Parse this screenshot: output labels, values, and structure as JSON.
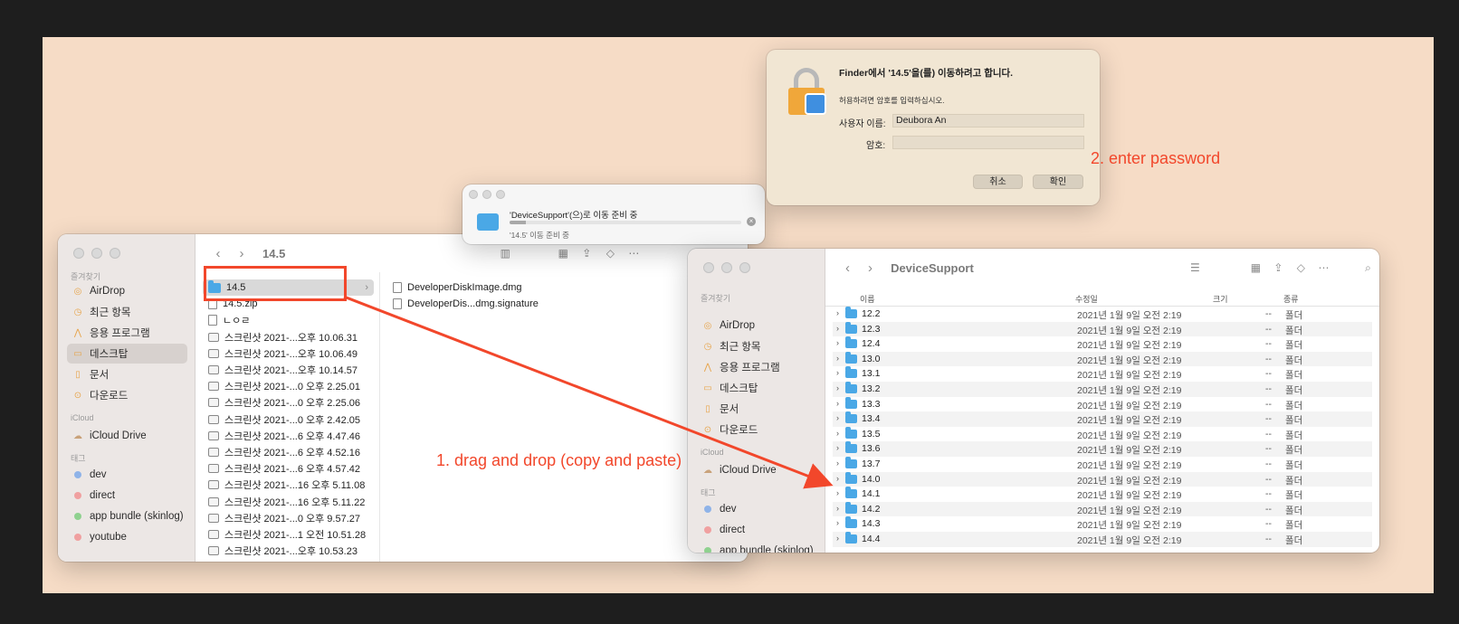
{
  "finder_left": {
    "title": "14.5",
    "sidebar": {
      "favorites_header": "즐겨찾기",
      "favorites": [
        {
          "label": "AirDrop",
          "icon": "airdrop-icon"
        },
        {
          "label": "최근 항목",
          "icon": "clock-icon"
        },
        {
          "label": "응용 프로그램",
          "icon": "apps-icon"
        },
        {
          "label": "데스크탑",
          "icon": "desktop-icon"
        },
        {
          "label": "문서",
          "icon": "document-icon"
        },
        {
          "label": "다운로드",
          "icon": "download-icon"
        }
      ],
      "icloud_header": "iCloud",
      "icloud": [
        {
          "label": "iCloud Drive",
          "icon": "cloud-icon"
        }
      ],
      "tags_header": "태그",
      "tags": [
        {
          "label": "dev",
          "color": "#8fb3e8"
        },
        {
          "label": "direct",
          "color": "#f0a0a0"
        },
        {
          "label": "app bundle (skinlog)",
          "color": "#8fd18f"
        },
        {
          "label": "youtube",
          "color": "#f0a0a0"
        }
      ]
    },
    "column1": [
      {
        "name": "14.5",
        "type": "folder"
      },
      {
        "name": "14.5.zip",
        "type": "zip"
      },
      {
        "name": "ㄴㅇㄹ",
        "type": "file"
      },
      {
        "name": "스크린샷 2021-...오후 10.06.31",
        "type": "image"
      },
      {
        "name": "스크린샷 2021-...오후 10.06.49",
        "type": "image"
      },
      {
        "name": "스크린샷 2021-...오후 10.14.57",
        "type": "image"
      },
      {
        "name": "스크린샷 2021-...0 오후 2.25.01",
        "type": "image"
      },
      {
        "name": "스크린샷 2021-...0 오후 2.25.06",
        "type": "image"
      },
      {
        "name": "스크린샷 2021-...0 오후 2.42.05",
        "type": "image"
      },
      {
        "name": "스크린샷 2021-...6 오후 4.47.46",
        "type": "image"
      },
      {
        "name": "스크린샷 2021-...6 오후 4.52.16",
        "type": "image"
      },
      {
        "name": "스크린샷 2021-...6 오후 4.57.42",
        "type": "image"
      },
      {
        "name": "스크린샷 2021-...16 오후 5.11.08",
        "type": "image"
      },
      {
        "name": "스크린샷 2021-...16 오후 5.11.22",
        "type": "image"
      },
      {
        "name": "스크린샷 2021-...0 오후 9.57.27",
        "type": "image"
      },
      {
        "name": "스크린샷 2021-...1 오전 10.51.28",
        "type": "image"
      },
      {
        "name": "스크린샷 2021-...오후 10.53.23",
        "type": "image"
      }
    ],
    "column2": [
      {
        "name": "DeveloperDiskImage.dmg",
        "type": "file"
      },
      {
        "name": "DeveloperDis...dmg.signature",
        "type": "file"
      }
    ]
  },
  "progress": {
    "title": "'DeviceSupport'(으)로 이동 준비 중",
    "status": "'14.5' 이동 준비 중",
    "fraction": 0.07
  },
  "auth": {
    "title": "Finder에서 '14.5'을(를) 이동하려고 합니다.",
    "subtitle": "허용하려면 암호를 입력하십시오.",
    "username_label": "사용자 이름:",
    "username_value": "Deubora An",
    "password_label": "암호:",
    "password_value": "",
    "cancel_label": "취소",
    "ok_label": "확인"
  },
  "finder_right": {
    "title": "DeviceSupport",
    "sidebar": {
      "favorites_header": "즐겨찾기",
      "favorites": [
        {
          "label": "AirDrop",
          "icon": "airdrop-icon"
        },
        {
          "label": "최근 항목",
          "icon": "clock-icon"
        },
        {
          "label": "응용 프로그램",
          "icon": "apps-icon"
        },
        {
          "label": "데스크탑",
          "icon": "desktop-icon"
        },
        {
          "label": "문서",
          "icon": "document-icon"
        },
        {
          "label": "다운로드",
          "icon": "download-icon"
        }
      ],
      "icloud_header": "iCloud",
      "icloud": [
        {
          "label": "iCloud Drive",
          "icon": "cloud-icon"
        }
      ],
      "tags_header": "태그",
      "tags": [
        {
          "label": "dev",
          "color": "#8fb3e8"
        },
        {
          "label": "direct",
          "color": "#f0a0a0"
        },
        {
          "label": "app bundle (skinlog)",
          "color": "#8fd18f"
        }
      ]
    },
    "columns": {
      "name": "이름",
      "date": "수정일",
      "size": "크기",
      "kind": "종류"
    },
    "rows": [
      {
        "name": "12.2",
        "date": "2021년 1월 9일 오전 2:19",
        "size": "--",
        "kind": "폴더"
      },
      {
        "name": "12.3",
        "date": "2021년 1월 9일 오전 2:19",
        "size": "--",
        "kind": "폴더"
      },
      {
        "name": "12.4",
        "date": "2021년 1월 9일 오전 2:19",
        "size": "--",
        "kind": "폴더"
      },
      {
        "name": "13.0",
        "date": "2021년 1월 9일 오전 2:19",
        "size": "--",
        "kind": "폴더"
      },
      {
        "name": "13.1",
        "date": "2021년 1월 9일 오전 2:19",
        "size": "--",
        "kind": "폴더"
      },
      {
        "name": "13.2",
        "date": "2021년 1월 9일 오전 2:19",
        "size": "--",
        "kind": "폴더"
      },
      {
        "name": "13.3",
        "date": "2021년 1월 9일 오전 2:19",
        "size": "--",
        "kind": "폴더"
      },
      {
        "name": "13.4",
        "date": "2021년 1월 9일 오전 2:19",
        "size": "--",
        "kind": "폴더"
      },
      {
        "name": "13.5",
        "date": "2021년 1월 9일 오전 2:19",
        "size": "--",
        "kind": "폴더"
      },
      {
        "name": "13.6",
        "date": "2021년 1월 9일 오전 2:19",
        "size": "--",
        "kind": "폴더"
      },
      {
        "name": "13.7",
        "date": "2021년 1월 9일 오전 2:19",
        "size": "--",
        "kind": "폴더"
      },
      {
        "name": "14.0",
        "date": "2021년 1월 9일 오전 2:19",
        "size": "--",
        "kind": "폴더"
      },
      {
        "name": "14.1",
        "date": "2021년 1월 9일 오전 2:19",
        "size": "--",
        "kind": "폴더"
      },
      {
        "name": "14.2",
        "date": "2021년 1월 9일 오전 2:19",
        "size": "--",
        "kind": "폴더"
      },
      {
        "name": "14.3",
        "date": "2021년 1월 9일 오전 2:19",
        "size": "--",
        "kind": "폴더"
      },
      {
        "name": "14.4",
        "date": "2021년 1월 9일 오전 2:19",
        "size": "--",
        "kind": "폴더"
      }
    ]
  },
  "annotations": {
    "drag": "1. drag and drop (copy and paste)",
    "password": "2. enter password",
    "color": "#f2472b"
  }
}
